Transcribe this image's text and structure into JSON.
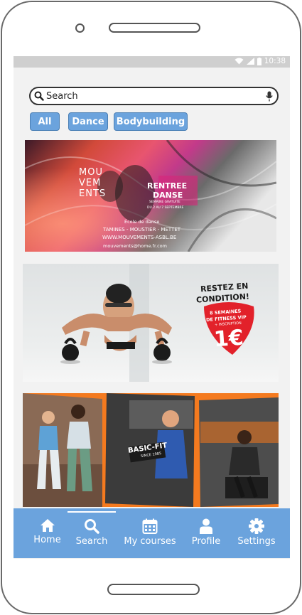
{
  "status_bar": {
    "time": "10:38"
  },
  "search": {
    "placeholder": "Search"
  },
  "filters": [
    {
      "label": "All"
    },
    {
      "label": "Dance"
    },
    {
      "label": "Bodybuilding"
    }
  ],
  "banners": {
    "mouvements": {
      "logo": "MOU\nVEM\nENTS",
      "headline_1": "RENTREE",
      "headline_2": "DANSE",
      "sub": "SEMAINE GRATUITE",
      "dates": "DU 2 AU 7 SEPTEMBRE",
      "school": "École de danse",
      "towns": "TAMINES - MOUSTIER - METTET",
      "site": "WWW.MOUVEMENTS-ASBL.BE",
      "email": "mouvements@home.fr.com"
    },
    "fitness": {
      "headline_1": "RESTEZ EN",
      "headline_2": "CONDITION!",
      "offer_1": "8 SEMAINES",
      "offer_2": "DE FITNESS VIP",
      "offer_3": "+ INSCRIPTION",
      "price": "1€"
    },
    "basicfit": {
      "brand_1": "BASIC-FIT",
      "brand_2": "SINCE 1985"
    }
  },
  "nav": [
    {
      "label": "Home",
      "icon": "home-icon"
    },
    {
      "label": "Search",
      "icon": "search-icon"
    },
    {
      "label": "My courses",
      "icon": "calendar-icon"
    },
    {
      "label": "Profile",
      "icon": "person-icon"
    },
    {
      "label": "Settings",
      "icon": "gear-icon"
    }
  ],
  "colors": {
    "accent": "#6ba3dd",
    "chip_border": "#4a7fb5",
    "promo_red": "#e2212a",
    "brand_orange": "#f47a1f"
  }
}
